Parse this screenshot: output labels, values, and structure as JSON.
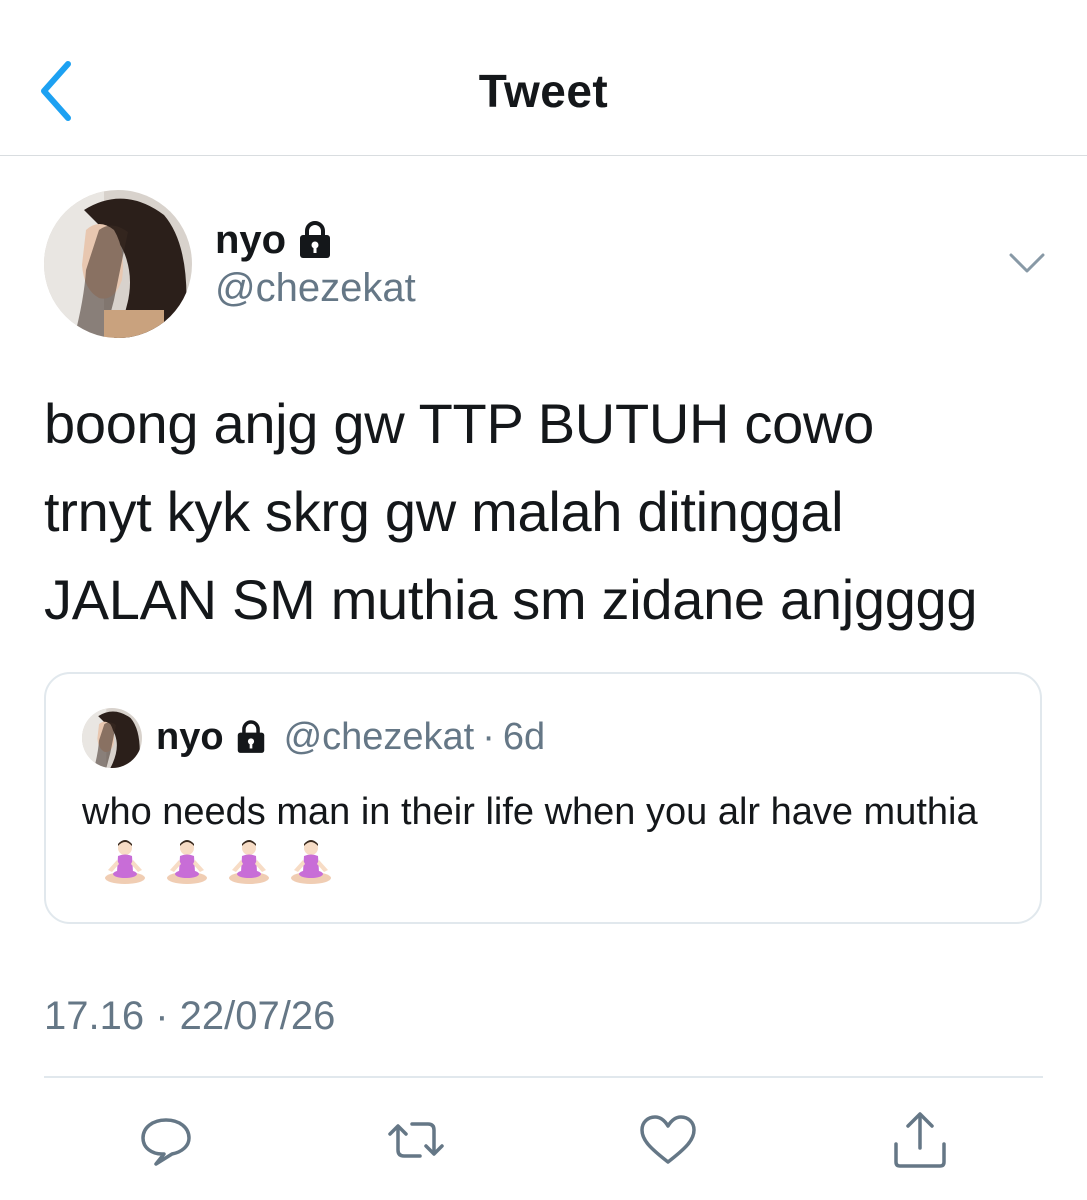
{
  "header": {
    "title": "Tweet",
    "back_icon": "chevron-left-icon",
    "accent_color": "#1da1f2"
  },
  "author": {
    "name": "nyo",
    "handle": "@chezekat",
    "protected_icon": "lock-icon"
  },
  "tweet": {
    "text": "boong anjg gw TTP BUTUH cowo\ntrnyt kyk skrg gw malah ditinggal\nJALAN SM muthia sm zidane anjgggg"
  },
  "quoted_tweet": {
    "name": "nyo",
    "handle": "@chezekat",
    "separator": "·",
    "time": "6d",
    "text": "who needs man in their life when you alr have muthia",
    "emoji": [
      "person-in-lotus-position",
      "person-in-lotus-position",
      "person-in-lotus-position",
      "person-in-lotus-position"
    ]
  },
  "timestamp": "17.16 · 22/07/26",
  "actions": [
    {
      "name": "reply",
      "icon": "reply-icon"
    },
    {
      "name": "retweet",
      "icon": "retweet-icon"
    },
    {
      "name": "like",
      "icon": "heart-icon"
    },
    {
      "name": "share",
      "icon": "share-icon"
    }
  ],
  "colors": {
    "text": "#14171a",
    "secondary": "#657786",
    "border": "#e1e8ed"
  }
}
